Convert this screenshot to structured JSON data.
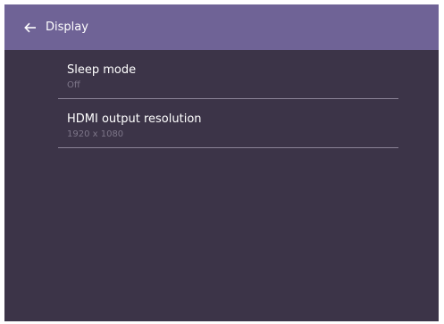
{
  "header": {
    "back_icon": "arrow-left-icon",
    "title": "Display"
  },
  "settings": [
    {
      "title": "Sleep mode",
      "value": "Off"
    },
    {
      "title": "HDMI output resolution",
      "value": "1920 x 1080"
    }
  ],
  "colors": {
    "header_bg": "#6f6396",
    "body_bg": "#3c3448",
    "title_text": "#ffffff",
    "value_text": "#7d7689",
    "divider": "#8a8296"
  }
}
